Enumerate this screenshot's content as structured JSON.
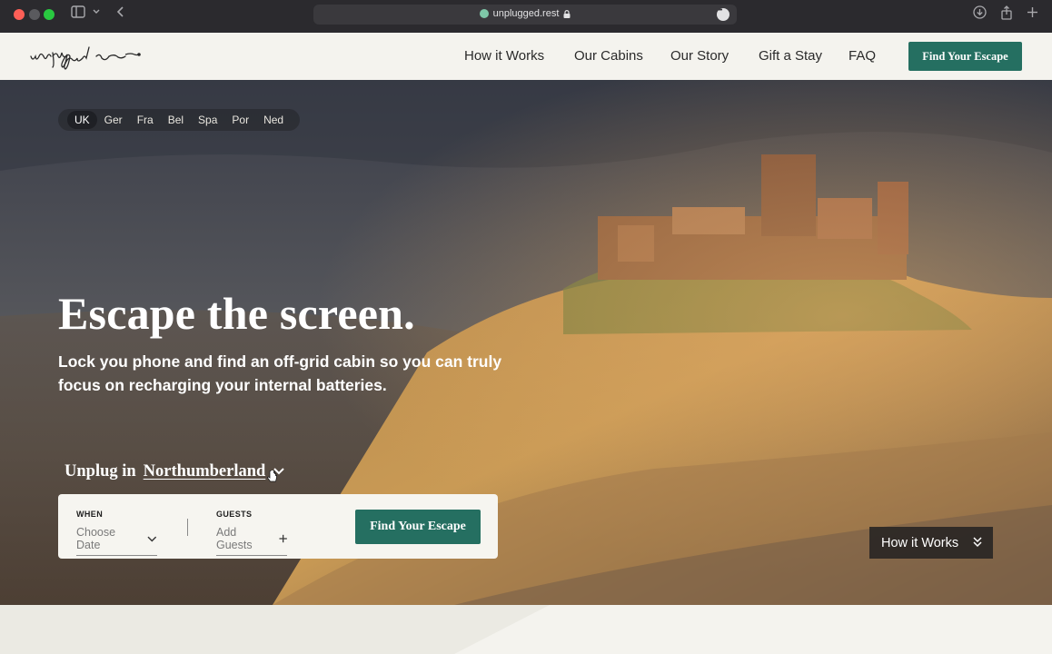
{
  "browser": {
    "url": "unplugged.rest",
    "colors": {
      "chrome_bg": "#2b2a2e",
      "close": "#fe5f57",
      "zoom": "#29c840"
    }
  },
  "header": {
    "logo_text": "unplugged",
    "nav": [
      {
        "label": "How it Works"
      },
      {
        "label": "Our Cabins"
      },
      {
        "label": "Our Story"
      },
      {
        "label": "Gift a Stay"
      },
      {
        "label": "FAQ"
      }
    ],
    "cta_label": "Find Your Escape"
  },
  "hero": {
    "languages": [
      "UK",
      "Ger",
      "Fra",
      "Bel",
      "Spa",
      "Por",
      "Ned"
    ],
    "active_language": "UK",
    "title": "Escape the screen.",
    "subtitle": "Lock you phone and find an off-grid cabin so you can truly focus on recharging your internal batteries.",
    "unplug_prefix": "Unplug in",
    "location": "Northumberland",
    "search": {
      "when_label": "WHEN",
      "when_placeholder": "Choose Date",
      "guests_label": "GUESTS",
      "guests_placeholder": "Add Guests",
      "button_label": "Find Your Escape"
    },
    "how_button_label": "How it Works"
  },
  "theme": {
    "brand_green": "#256f61",
    "page_bg": "#f4f3ee"
  }
}
